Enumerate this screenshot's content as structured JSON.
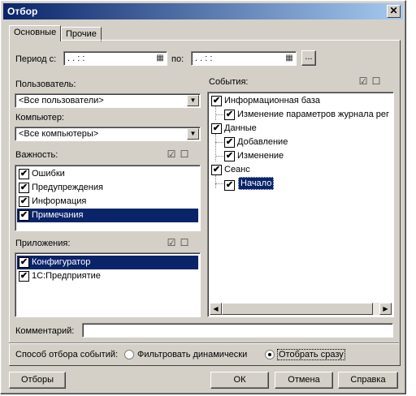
{
  "window": {
    "title": "Отбор",
    "close_glyph": "✕"
  },
  "tabs": [
    {
      "label": "Основные",
      "active": true
    },
    {
      "label": "Прочие",
      "active": false
    }
  ],
  "period": {
    "label": "Период с:",
    "from_value": " .  .     : :",
    "to_label": "по:",
    "to_value": " .  .     : :",
    "more_button": "..."
  },
  "user": {
    "label": "Пользователь:",
    "value": "<Все пользователи>"
  },
  "computer": {
    "label": "Компьютер:",
    "value": "<Все компьютеры>"
  },
  "importance": {
    "label": "Важность:",
    "items": [
      {
        "label": "Ошибки",
        "checked": true,
        "selected": false
      },
      {
        "label": "Предупреждения",
        "checked": true,
        "selected": false
      },
      {
        "label": "Информация",
        "checked": true,
        "selected": false
      },
      {
        "label": "Примечания",
        "checked": true,
        "selected": true
      }
    ]
  },
  "applications": {
    "label": "Приложения:",
    "items": [
      {
        "label": "Конфигуратор",
        "checked": true,
        "selected": true
      },
      {
        "label": "1С:Предприятие",
        "checked": true,
        "selected": false
      }
    ]
  },
  "events": {
    "label": "События:",
    "tree": [
      {
        "label": "Информационная база",
        "level": 0,
        "checked": true
      },
      {
        "label": "Изменение параметров журнала рег",
        "level": 1,
        "checked": true
      },
      {
        "label": "Данные",
        "level": 0,
        "checked": true
      },
      {
        "label": "Добавление",
        "level": 1,
        "checked": true
      },
      {
        "label": "Изменение",
        "level": 1,
        "checked": true
      },
      {
        "label": "Сеанс",
        "level": 0,
        "checked": true
      },
      {
        "label": "Начало",
        "level": 1,
        "checked": true,
        "selected": true
      }
    ]
  },
  "comment": {
    "label": "Комментарий:",
    "value": ""
  },
  "filter_mode": {
    "label": "Способ отбора событий:",
    "options": [
      {
        "label": "Фильтровать динамически",
        "selected": false
      },
      {
        "label": "Отобрать сразу",
        "selected": true
      }
    ]
  },
  "buttons": {
    "filters": "Отборы",
    "ok": "ОК",
    "cancel": "Отмена",
    "help": "Справка"
  },
  "icons": {
    "check": "✔",
    "combo_arrow": "▼",
    "calendar": "▦",
    "check_all": "☑",
    "uncheck_all": "☐",
    "scroll_left": "◀",
    "scroll_right": "▶"
  }
}
